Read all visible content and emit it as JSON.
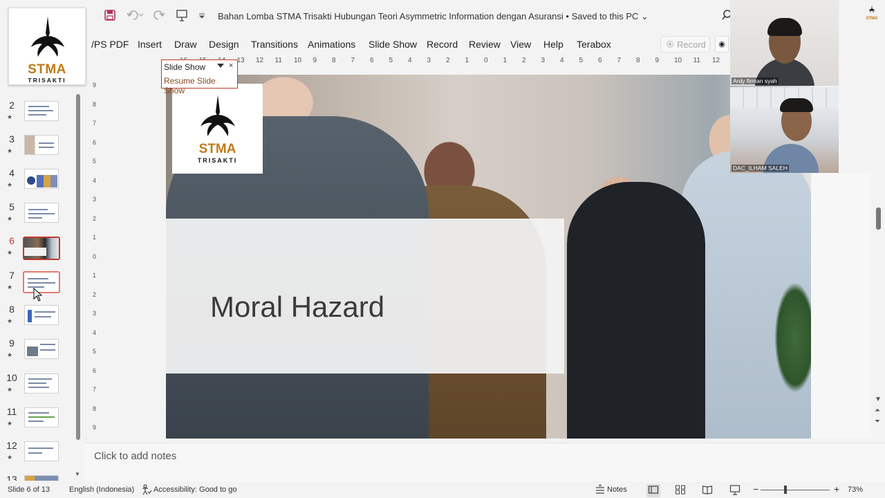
{
  "titlebar": {
    "doc_title": "Bahan Lomba STMA Trisakti Hubungan Teori Asymmetric Information dengan Asuransi • Saved to this PC ⌄"
  },
  "ribbon": {
    "tabs": [
      "/PS PDF",
      "Insert",
      "Draw",
      "Design",
      "Transitions",
      "Animations",
      "Slide Show",
      "Record",
      "Review",
      "View",
      "Help",
      "Terabox"
    ],
    "record_label": "Record"
  },
  "logo": {
    "name": "STMA",
    "sub": "TRISAKTI"
  },
  "slideshow_popup": {
    "title": "Slide Show",
    "close": "×",
    "resume": "Resume Slide Show"
  },
  "thumbnails": [
    {
      "num": "2"
    },
    {
      "num": "3"
    },
    {
      "num": "4"
    },
    {
      "num": "5"
    },
    {
      "num": "6"
    },
    {
      "num": "7"
    },
    {
      "num": "8"
    },
    {
      "num": "9"
    },
    {
      "num": "10"
    },
    {
      "num": "11"
    },
    {
      "num": "12"
    },
    {
      "num": "13"
    }
  ],
  "hruler": [
    "16",
    "15",
    "14",
    "13",
    "12",
    "11",
    "10",
    "9",
    "8",
    "7",
    "6",
    "5",
    "4",
    "3",
    "2",
    "1",
    "0",
    "1",
    "2",
    "3",
    "4",
    "5",
    "6",
    "7",
    "8",
    "9",
    "10",
    "11",
    "12"
  ],
  "vruler": [
    "9",
    "8",
    "7",
    "6",
    "5",
    "4",
    "3",
    "2",
    "1",
    "0",
    "1",
    "2",
    "3",
    "4",
    "5",
    "6",
    "7",
    "8",
    "9"
  ],
  "slide": {
    "title": "Moral Hazard",
    "logo_name": "STMA",
    "logo_sub": "TRISAKTI"
  },
  "video": {
    "participant1": "Ardy firman syah",
    "participant2": "DAC_ILHAM SALEH",
    "corner_logo": "STMA"
  },
  "notes": {
    "placeholder": "Click to add notes"
  },
  "status": {
    "slide_counter": "Slide 6 of 13",
    "language": "English (Indonesia)",
    "accessibility": "Accessibility: Good to go",
    "notes_label": "Notes",
    "zoom": "73%"
  },
  "colors": {
    "accent": "#c0392b",
    "brand_gold": "#c07a18"
  }
}
